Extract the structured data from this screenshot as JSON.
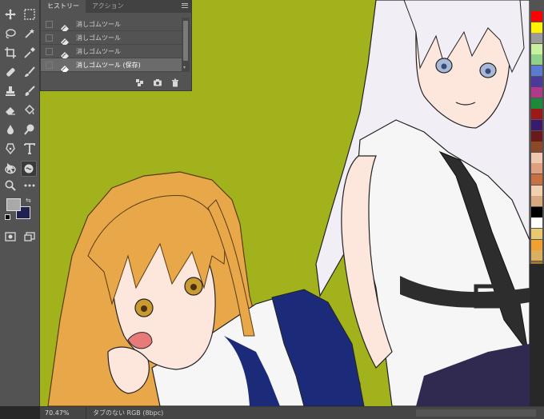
{
  "history_panel": {
    "tabs": [
      "ヒストリー",
      "アクション"
    ],
    "items": [
      {
        "label": "消しゴムツール",
        "selected": false
      },
      {
        "label": "消しゴムツール",
        "selected": false
      },
      {
        "label": "消しゴムツール",
        "selected": false
      },
      {
        "label": "消しゴムツール (保存)",
        "selected": true
      }
    ],
    "footer_icons": [
      "new-document-from-state-icon",
      "snapshot-camera-icon",
      "trash-icon"
    ]
  },
  "toolbar": {
    "tools": [
      "move-icon",
      "marquee-icon",
      "lasso-icon",
      "magic-wand-icon",
      "crop-icon",
      "eyedropper-icon",
      "spot-healing-icon",
      "brush-icon",
      "clone-stamp-icon",
      "history-brush-icon",
      "eraser-icon",
      "paint-bucket-icon",
      "blur-icon",
      "dodge-icon",
      "pen-icon",
      "type-icon",
      "path-selection-icon",
      "rectangle-icon",
      "hand-icon",
      "zoom-icon",
      "more-tools-icon"
    ],
    "foreground_color": "#a9a9a9",
    "background_color": "#1f2250"
  },
  "swatches": [
    "#ff0000",
    "#fff200",
    "#9a9a9a",
    "#c8f0a0",
    "#8fd08a",
    "#5a7bd0",
    "#4a3a9a",
    "#b03a8a",
    "#1c8a3a",
    "#9a1a1a",
    "#3a1a6a",
    "#6a1a1a",
    "#8a4a2a",
    "#f0c8b0",
    "#e0a080",
    "#c87040",
    "#f0d0b0",
    "#d8a880",
    "#000000",
    "#ffffff",
    "#e8c870",
    "#f0a030",
    "#d8b060",
    "#a07830"
  ],
  "status": {
    "zoom": "70.47%",
    "doc_info": "タブのない RGB (8bpc)"
  },
  "colors": {
    "canvas_bg": "#a2b21c",
    "panel_bg": "#535353",
    "dark_bg": "#282828"
  }
}
